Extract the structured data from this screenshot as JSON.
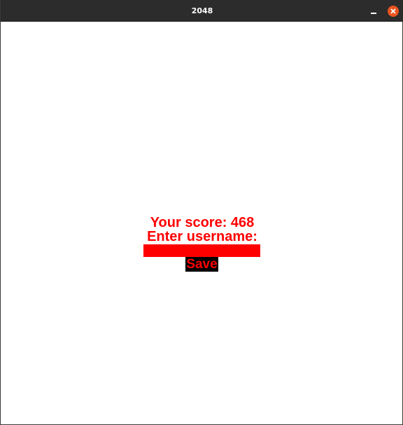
{
  "window": {
    "title": "2048",
    "close_icon": "close-icon",
    "minimize_icon": "minimize-icon"
  },
  "game_over": {
    "score_text": "Your score: 468",
    "prompt_text": "Enter username:",
    "username_value": "",
    "save_label": "Save"
  },
  "colors": {
    "titlebar": "#2c2c2c",
    "close_button": "#e95420",
    "text": "#ff0000",
    "input_background": "#ff0000",
    "button_background": "#000000"
  }
}
